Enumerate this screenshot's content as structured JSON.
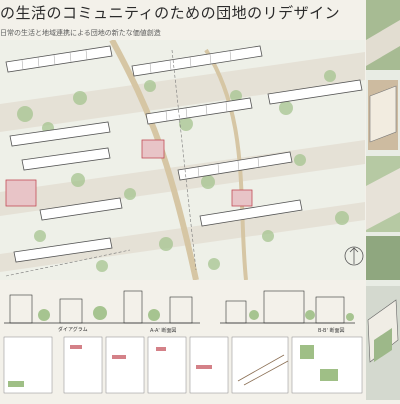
{
  "poster": {
    "title": "の生活のコミュニティのための団地のリデザイン",
    "subtitle": "日常の生活と地域連携による団地の新たな価値創造"
  },
  "sections": {
    "label_a": "A-A' 断面図",
    "label_b": "B-B' 断面図",
    "diagram": "ダイアグラム"
  },
  "colors": {
    "paper": "#f3f1ea",
    "green": "#9fbf86",
    "road": "#e4ded4",
    "accent": "#c24d57"
  }
}
